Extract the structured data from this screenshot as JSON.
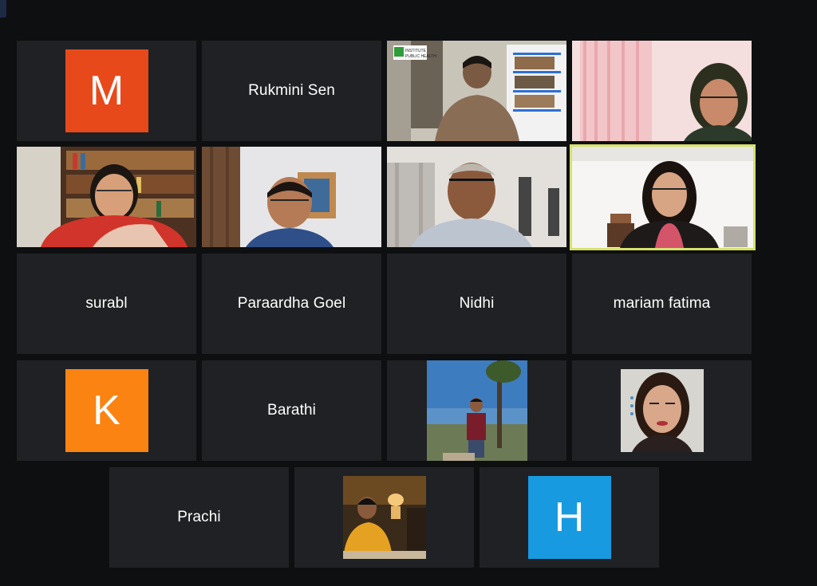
{
  "participants": [
    {
      "id": "m",
      "type": "avatar",
      "letter": "M",
      "color": "#e8491a"
    },
    {
      "id": "rukmini",
      "type": "name",
      "name": "Rukmini Sen"
    },
    {
      "id": "video-man-library",
      "type": "video"
    },
    {
      "id": "video-woman-pink",
      "type": "video"
    },
    {
      "id": "video-woman-books",
      "type": "video"
    },
    {
      "id": "video-man-brown-wall",
      "type": "video"
    },
    {
      "id": "video-man-glasses",
      "type": "video"
    },
    {
      "id": "video-young-woman",
      "type": "video",
      "active_speaker": true
    },
    {
      "id": "surabl",
      "type": "name",
      "name": "surabl"
    },
    {
      "id": "paraardha",
      "type": "name",
      "name": "Paraardha Goel"
    },
    {
      "id": "nidhi",
      "type": "name",
      "name": "Nidhi"
    },
    {
      "id": "mariam",
      "type": "name",
      "name": "mariam fatima"
    },
    {
      "id": "k",
      "type": "avatar",
      "letter": "K",
      "color": "#fb8312"
    },
    {
      "id": "barathi",
      "type": "name",
      "name": "Barathi"
    },
    {
      "id": "photo-man-outdoors",
      "type": "photo"
    },
    {
      "id": "photo-woman-portrait",
      "type": "photo"
    },
    {
      "id": "prachi",
      "type": "name",
      "name": "Prachi"
    },
    {
      "id": "photo-woman-yellow",
      "type": "photo"
    },
    {
      "id": "h",
      "type": "avatar",
      "letter": "H",
      "color": "#189ae0"
    }
  ],
  "video_sign_text": "INSTITUTE PUBLIC HEALTH"
}
